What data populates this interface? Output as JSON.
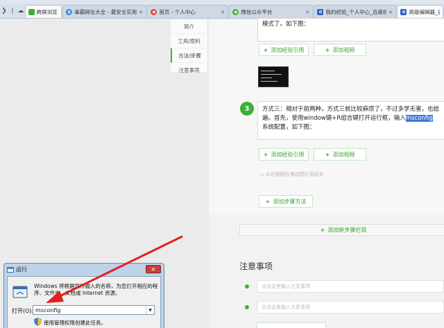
{
  "browser": {
    "tabs": [
      {
        "label": "跨屏浏览",
        "icon": "green-square-icon",
        "color": "#3cb034",
        "active": true
      },
      {
        "label": "毒霸网址大全 - 最安全实用的网",
        "icon": "duba-icon",
        "color": "#2b7bd6",
        "active": false
      },
      {
        "label": "首页 - 个人中心",
        "icon": "baidu-icon",
        "color": "#e8413c",
        "active": false
      },
      {
        "label": "微信公众平台",
        "icon": "wechat-icon",
        "color": "#3cb034",
        "active": false
      },
      {
        "label": "我的经验_个人中心_百度经验",
        "icon": "paw-icon",
        "color": "#3060c8",
        "active": false
      },
      {
        "label": "高级编辑器_百度",
        "icon": "paw-icon",
        "color": "#3060c8",
        "active": true
      }
    ]
  },
  "sidenav": {
    "items": [
      "简介",
      "工具/原料",
      "方法/步骤",
      "注意事项"
    ],
    "active_index": 2
  },
  "steps": {
    "step2_tail": "模式了。如下图：",
    "add_exp_ref": "添加经验引用",
    "add_video": "添加视频",
    "step3_number": "3",
    "step3_text_a": "方式三：相对于前两种，方式三就比较麻烦了，不过多学无害，也给",
    "step3_text_b": "遍。首先，使用window键+R组合键打开运行框，输入",
    "step3_highlight": "msconfig",
    "step3_text_c": "系统配置，如下图：",
    "upload_hint": "从右侧图片拖动图片到此处",
    "add_step_method": "添加步骤方法",
    "add_step_column": "添加新步骤栏目"
  },
  "notes": {
    "title": "注意事项",
    "placeholder": "点击这里输入注意事项"
  },
  "run_dialog": {
    "title": "运行",
    "close": "✕",
    "description": "Windows 将根据您所输入的名称，为您打开相应的程序、文件夹、文档或 Internet 资源。",
    "open_label": "打开(O):",
    "input_value": "msconfig",
    "admin_text": "使用管理权限创建此任务。"
  },
  "colors": {
    "accent": "#3cb034",
    "arrow": "#e02020",
    "highlight": "#3e76d6"
  }
}
